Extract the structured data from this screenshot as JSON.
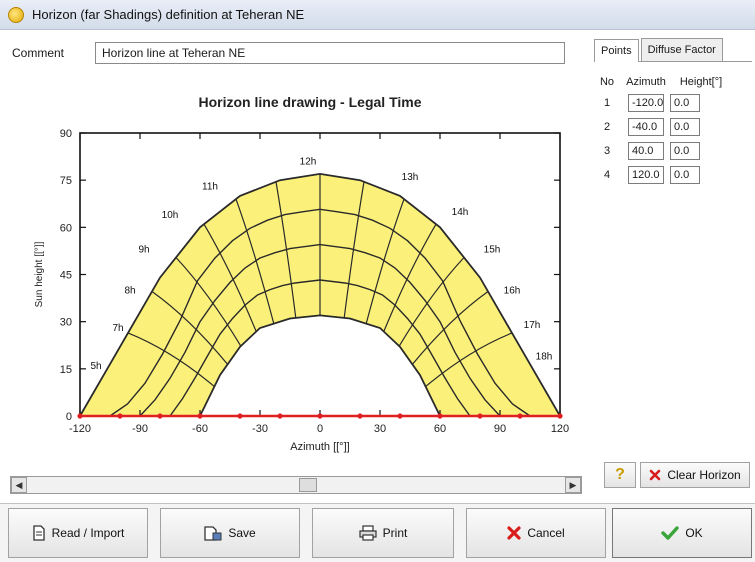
{
  "window": {
    "title": "Horizon (far Shadings) definition at Teheran NE",
    "icon": "sun-icon"
  },
  "comment": {
    "label": "Comment",
    "value": "Horizon line at Teheran NE"
  },
  "tabs": [
    {
      "label": "Points",
      "active": true
    },
    {
      "label": "Diffuse Factor",
      "active": false
    }
  ],
  "points_table": {
    "headers": {
      "no": "No",
      "azimuth": "Azimuth",
      "height": "Height[°]"
    },
    "rows": [
      {
        "no": "1",
        "azimuth": "-120.0",
        "height": "0.0"
      },
      {
        "no": "2",
        "azimuth": "-40.0",
        "height": "0.0"
      },
      {
        "no": "3",
        "azimuth": "40.0",
        "height": "0.0"
      },
      {
        "no": "4",
        "azimuth": "120.0",
        "height": "0.0"
      }
    ]
  },
  "buttons": {
    "help": "?",
    "clear_horizon": "Clear Horizon",
    "read_import": "Read / Import",
    "save": "Save",
    "print": "Print",
    "cancel": "Cancel",
    "ok": "OK"
  },
  "colors": {
    "band_fill": "#fbf17a",
    "curve": "#2a2a2a",
    "horizon": "#e02020",
    "ok_check": "#3aa53a",
    "cancel_x": "#d81c1c"
  },
  "chart_data": {
    "type": "area",
    "title": "Horizon line drawing - Legal Time",
    "xlabel": "Azimuth [[°]]",
    "ylabel": "Sun height [[°]]",
    "xlim": [
      -120,
      120
    ],
    "ylim": [
      0,
      90
    ],
    "x_ticks": [
      "-120",
      "-90",
      "-60",
      "-30",
      "0",
      "30",
      "60",
      "90",
      "120"
    ],
    "y_ticks": [
      "0",
      "15",
      "30",
      "45",
      "60",
      "75",
      "90"
    ],
    "sun_path_outer": [
      [
        -120,
        0
      ],
      [
        -100,
        22
      ],
      [
        -80,
        44
      ],
      [
        -60,
        60
      ],
      [
        -40,
        70
      ],
      [
        -20,
        75
      ],
      [
        0,
        77
      ],
      [
        20,
        75
      ],
      [
        40,
        70
      ],
      [
        60,
        60
      ],
      [
        80,
        44
      ],
      [
        100,
        22
      ],
      [
        120,
        0
      ]
    ],
    "sun_path_inner": [
      [
        -60,
        0
      ],
      [
        -50,
        13
      ],
      [
        -40,
        22
      ],
      [
        -30,
        28
      ],
      [
        -15,
        31
      ],
      [
        0,
        32
      ],
      [
        15,
        31
      ],
      [
        30,
        28
      ],
      [
        40,
        22
      ],
      [
        50,
        13
      ],
      [
        60,
        0
      ]
    ],
    "hour_labels": [
      {
        "label": "5h",
        "x": -112,
        "y": 15
      },
      {
        "label": "7h",
        "x": -101,
        "y": 27
      },
      {
        "label": "8h",
        "x": -95,
        "y": 39
      },
      {
        "label": "9h",
        "x": -88,
        "y": 52
      },
      {
        "label": "10h",
        "x": -75,
        "y": 63
      },
      {
        "label": "11h",
        "x": -55,
        "y": 72
      },
      {
        "label": "12h",
        "x": -6,
        "y": 80
      },
      {
        "label": "13h",
        "x": 45,
        "y": 75
      },
      {
        "label": "14h",
        "x": 70,
        "y": 64
      },
      {
        "label": "15h",
        "x": 86,
        "y": 52
      },
      {
        "label": "16h",
        "x": 96,
        "y": 39
      },
      {
        "label": "17h",
        "x": 106,
        "y": 28
      },
      {
        "label": "18h",
        "x": 112,
        "y": 18
      }
    ],
    "horizon_line": [
      [
        -120,
        0
      ],
      [
        -40,
        0
      ],
      [
        40,
        0
      ],
      [
        120,
        0
      ]
    ],
    "grid": false
  }
}
